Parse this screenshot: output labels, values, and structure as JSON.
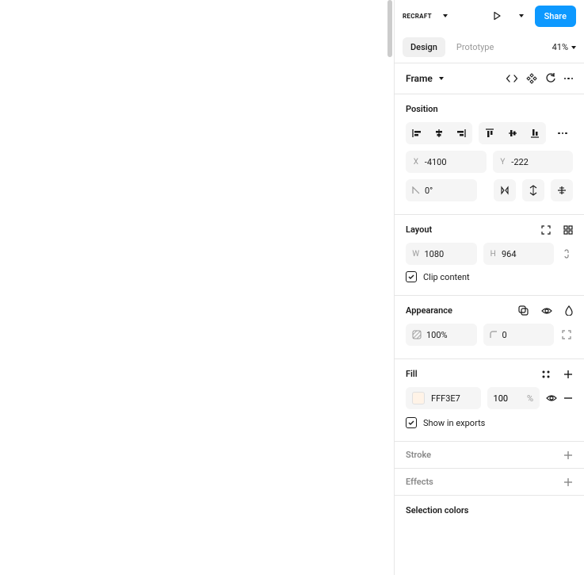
{
  "toolbar": {
    "brand": "RECRAFT",
    "share": "Share"
  },
  "tabs": {
    "design": "Design",
    "prototype": "Prototype",
    "zoom": "41%"
  },
  "frame": {
    "title": "Frame"
  },
  "position": {
    "title": "Position",
    "x_label": "X",
    "x": "-4100",
    "y_label": "Y",
    "y": "-222",
    "rotation": "0°"
  },
  "layout": {
    "title": "Layout",
    "w_label": "W",
    "w": "1080",
    "h_label": "H",
    "h": "964",
    "clip": "Clip content"
  },
  "appearance": {
    "title": "Appearance",
    "opacity": "100%",
    "radius": "0"
  },
  "fill": {
    "title": "Fill",
    "hex": "FFF3E7",
    "opacity": "100",
    "pct": "%",
    "show_exports": "Show in exports"
  },
  "stroke": {
    "title": "Stroke"
  },
  "effects": {
    "title": "Effects"
  },
  "selection_colors": {
    "title": "Selection colors"
  }
}
